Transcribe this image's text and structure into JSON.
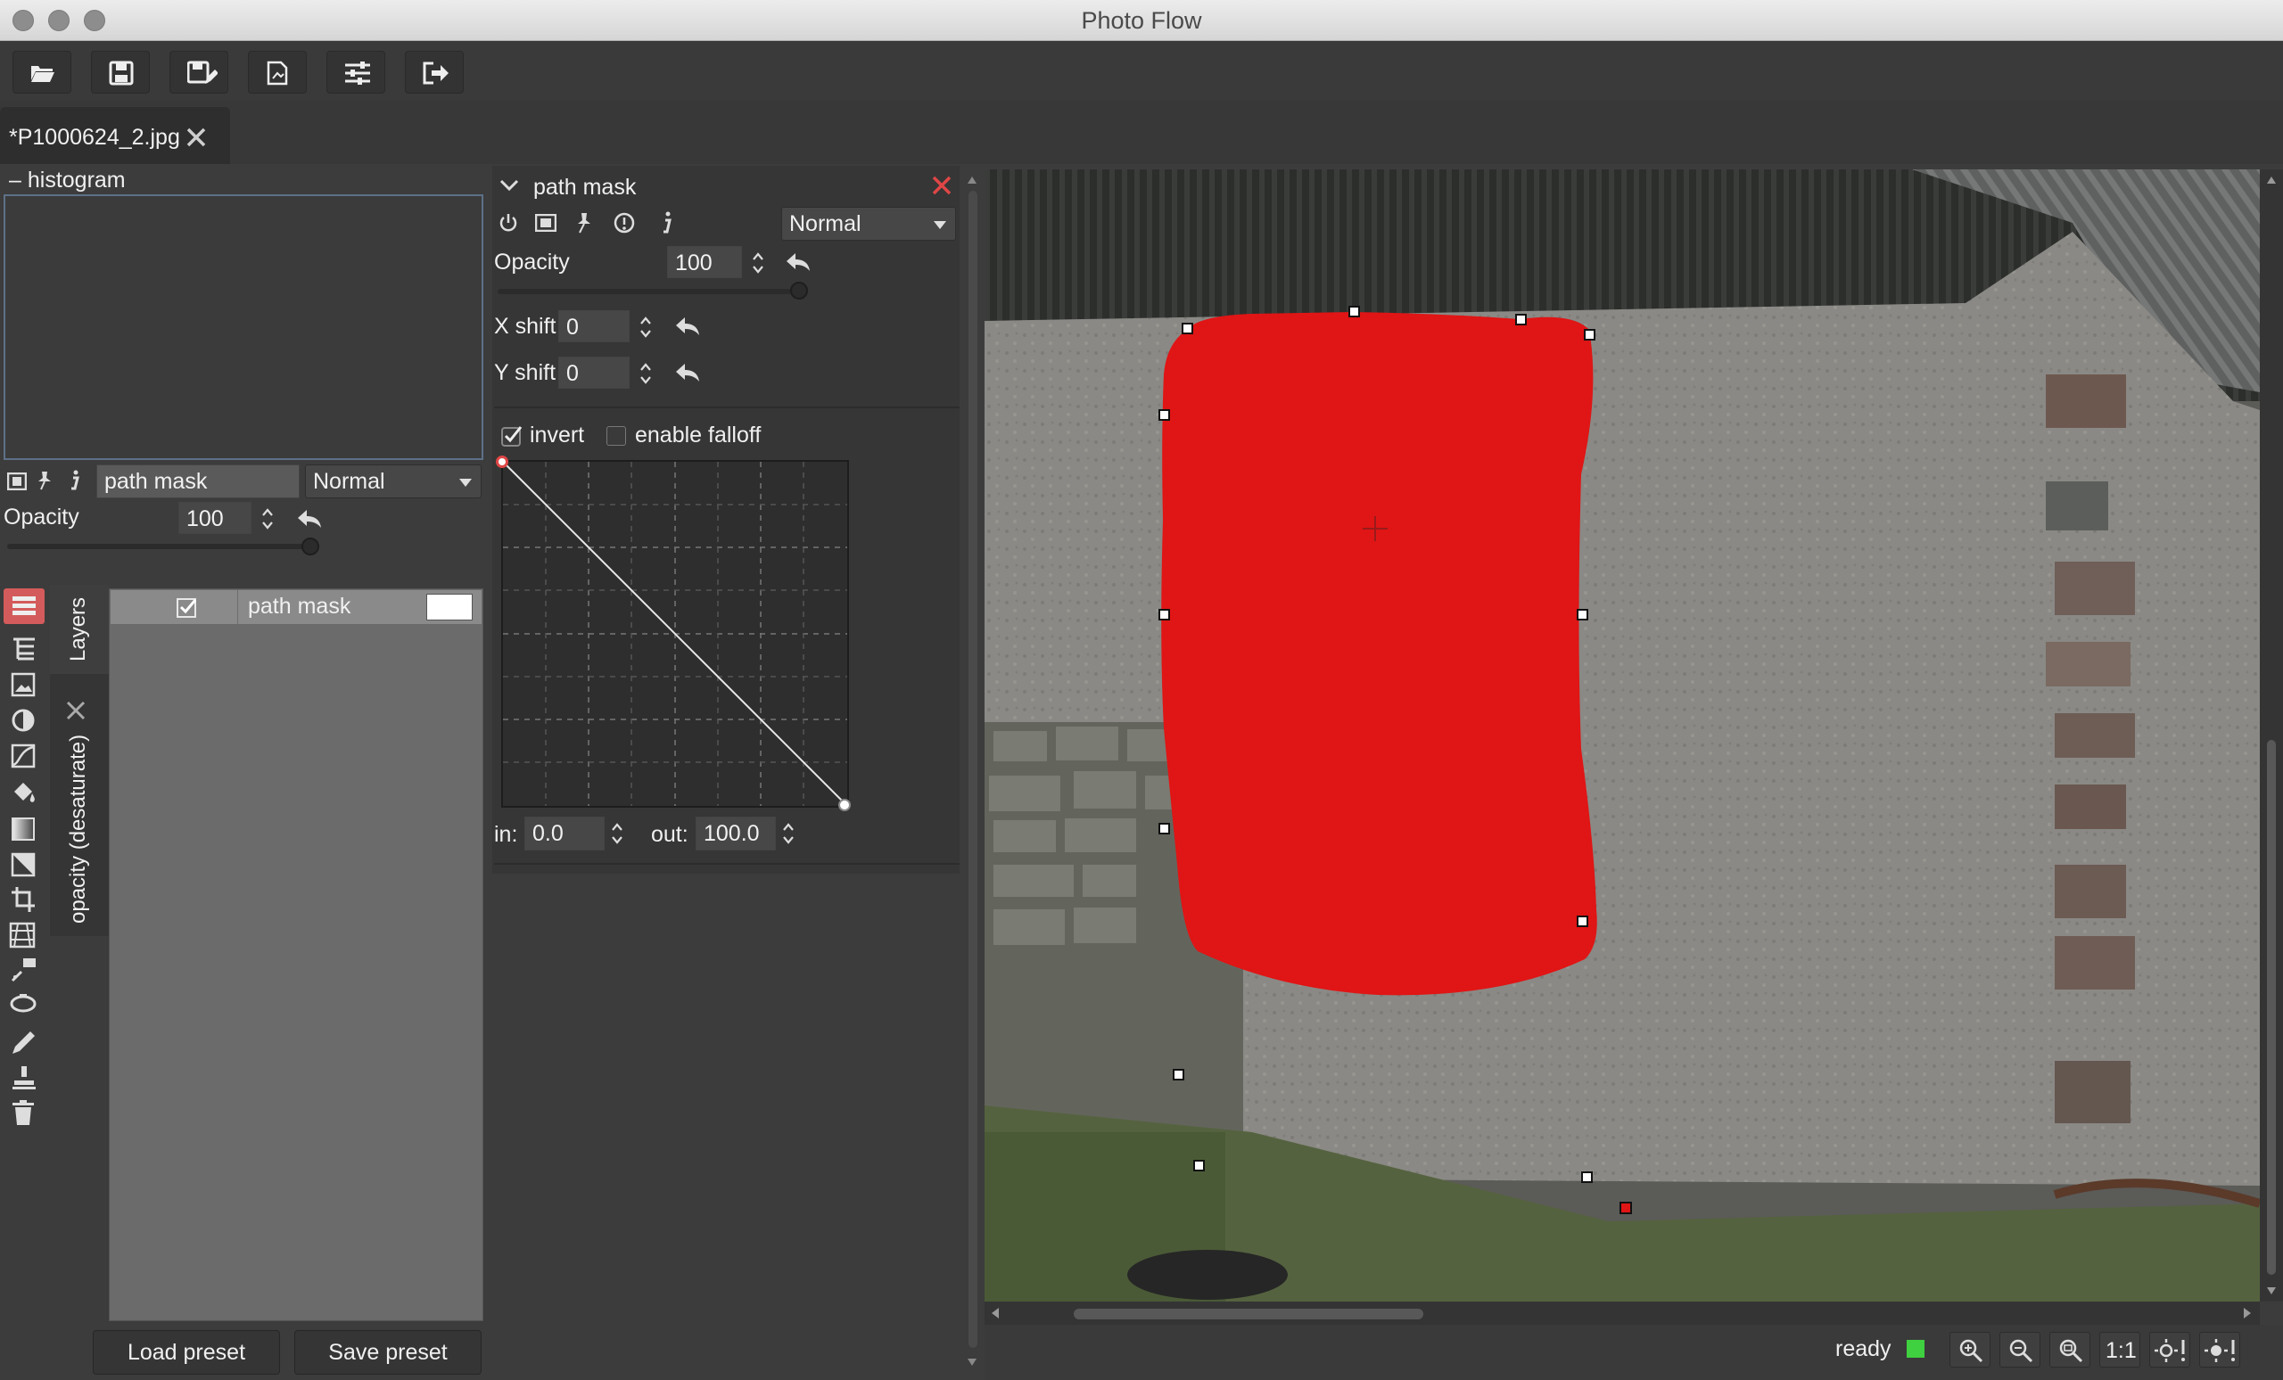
{
  "window": {
    "title": "Photo Flow"
  },
  "toolbar": {
    "buttons": [
      "open-icon",
      "save-icon",
      "save-as-icon",
      "export-icon",
      "settings-icon",
      "exit-icon"
    ]
  },
  "tab": {
    "filename": "*P1000624_2.jpg"
  },
  "histogram": {
    "header": "histogram"
  },
  "layer_props": {
    "name": "path mask",
    "blend_mode": "Normal",
    "opacity_label": "Opacity",
    "opacity_value": "100"
  },
  "side_tabs": {
    "layers": "Layers",
    "opacity": "opacity (desaturate)"
  },
  "layers": [
    {
      "name": "path mask",
      "visible": true
    }
  ],
  "presets": {
    "load": "Load preset",
    "save": "Save preset"
  },
  "tool_panel": {
    "title": "path mask",
    "blend_mode": "Normal",
    "opacity_label": "Opacity",
    "opacity_value": "100",
    "xshift_label": "X shift",
    "xshift_value": "0",
    "yshift_label": "Y shift",
    "yshift_value": "0",
    "invert_label": "invert",
    "invert_checked": true,
    "falloff_label": "enable falloff",
    "falloff_checked": false,
    "in_label": "in:",
    "in_value": "0.0",
    "out_label": "out:",
    "out_value": "100.0"
  },
  "status": {
    "text": "ready",
    "ratio_label": "1:1",
    "indicator_color": "#3fd13f"
  },
  "colors": {
    "mask": "#e01515",
    "accent_border": "#5d7088"
  }
}
